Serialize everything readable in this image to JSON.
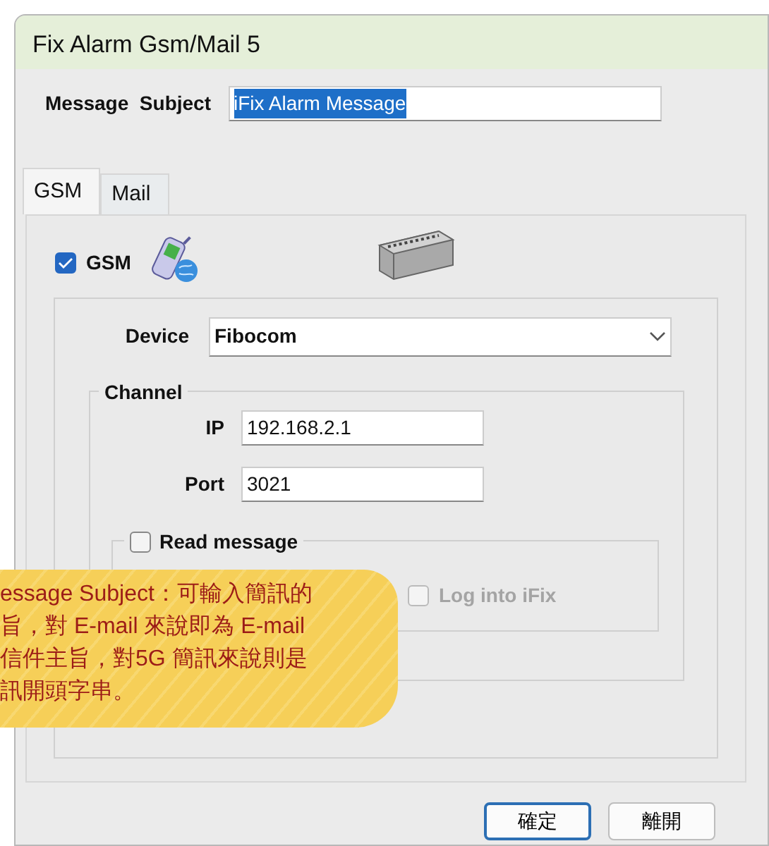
{
  "window": {
    "title": "Fix Alarm Gsm/Mail 5"
  },
  "message_subject": {
    "label": "Message  Subject",
    "value": "iFix Alarm Message",
    "selected": true
  },
  "tabs": [
    {
      "label": "GSM",
      "selected": true
    },
    {
      "label": "Mail",
      "selected": false
    }
  ],
  "gsm": {
    "label": "GSM",
    "checked": true
  },
  "device": {
    "label": "Device",
    "value": "Fibocom"
  },
  "channel": {
    "title": "Channel",
    "fields": [
      {
        "label": "IP",
        "value": "192.168.2.1"
      },
      {
        "label": "Port",
        "value": "3021"
      }
    ]
  },
  "read_message": {
    "label": "Read message",
    "checked": false,
    "options": [
      {
        "label": "Log into iFix",
        "checked": false,
        "disabled": true
      }
    ]
  },
  "buttons": [
    {
      "label": "確定",
      "default": true
    },
    {
      "label": "離開",
      "default": false
    }
  ],
  "annotation": {
    "lines": [
      "essage Subject：可輸入簡訊的",
      "旨，對 E-mail 來說即為 E-mail",
      "信件主旨，對5G 簡訊來說則是",
      "訊開頭字串。"
    ]
  }
}
